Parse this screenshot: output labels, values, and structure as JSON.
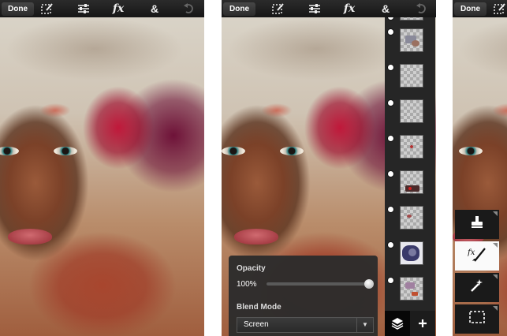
{
  "screen1": {
    "done_label": "Done",
    "toolbar_icons": [
      "selection-edit-icon",
      "adjustments-icon",
      "fx-icon",
      "ampersand-icon",
      "undo-icon"
    ]
  },
  "screen2": {
    "done_label": "Done",
    "toolbar_icons": [
      "selection-edit-icon",
      "adjustments-icon",
      "fx-icon",
      "ampersand-icon",
      "undo-icon"
    ],
    "layers_panel": {
      "layers": [
        {
          "visible": true
        },
        {
          "visible": true
        },
        {
          "visible": true
        },
        {
          "visible": true
        },
        {
          "visible": true
        },
        {
          "visible": true
        },
        {
          "visible": true
        },
        {
          "visible": true
        }
      ],
      "bottom_buttons": [
        "layers-stack-icon",
        "add-layer-icon"
      ]
    },
    "layer_properties": {
      "opacity_label": "Opacity",
      "opacity_value": "100%",
      "opacity_fraction": 1.0,
      "blend_mode_label": "Blend Mode",
      "blend_mode_value": "Screen"
    }
  },
  "screen3": {
    "done_label": "Done",
    "tool_strip": [
      "stamp-icon",
      "fx-brush-icon",
      "magic-wand-icon",
      "selection-marquee-icon"
    ],
    "active_tool": "fx-brush-icon"
  },
  "colors": {
    "toolbar": "#1f1f1f",
    "panel": "#262626",
    "popup": "#2c2c2c",
    "active_tool": "#fafafa"
  }
}
